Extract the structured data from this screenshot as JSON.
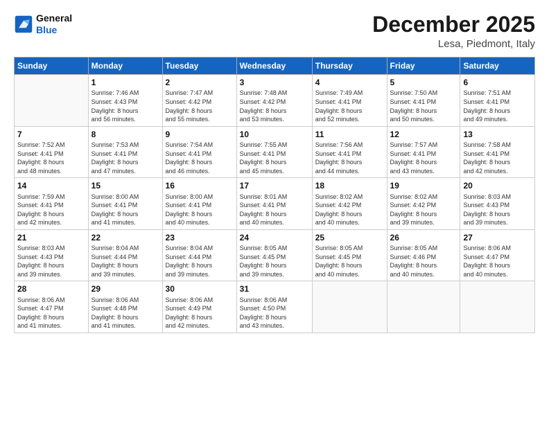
{
  "logo": {
    "line1": "General",
    "line2": "Blue"
  },
  "header": {
    "month": "December 2025",
    "location": "Lesa, Piedmont, Italy"
  },
  "days_of_week": [
    "Sunday",
    "Monday",
    "Tuesday",
    "Wednesday",
    "Thursday",
    "Friday",
    "Saturday"
  ],
  "weeks": [
    [
      {
        "day": "",
        "info": ""
      },
      {
        "day": "1",
        "info": "Sunrise: 7:46 AM\nSunset: 4:43 PM\nDaylight: 8 hours\nand 56 minutes."
      },
      {
        "day": "2",
        "info": "Sunrise: 7:47 AM\nSunset: 4:42 PM\nDaylight: 8 hours\nand 55 minutes."
      },
      {
        "day": "3",
        "info": "Sunrise: 7:48 AM\nSunset: 4:42 PM\nDaylight: 8 hours\nand 53 minutes."
      },
      {
        "day": "4",
        "info": "Sunrise: 7:49 AM\nSunset: 4:41 PM\nDaylight: 8 hours\nand 52 minutes."
      },
      {
        "day": "5",
        "info": "Sunrise: 7:50 AM\nSunset: 4:41 PM\nDaylight: 8 hours\nand 50 minutes."
      },
      {
        "day": "6",
        "info": "Sunrise: 7:51 AM\nSunset: 4:41 PM\nDaylight: 8 hours\nand 49 minutes."
      }
    ],
    [
      {
        "day": "7",
        "info": "Sunrise: 7:52 AM\nSunset: 4:41 PM\nDaylight: 8 hours\nand 48 minutes."
      },
      {
        "day": "8",
        "info": "Sunrise: 7:53 AM\nSunset: 4:41 PM\nDaylight: 8 hours\nand 47 minutes."
      },
      {
        "day": "9",
        "info": "Sunrise: 7:54 AM\nSunset: 4:41 PM\nDaylight: 8 hours\nand 46 minutes."
      },
      {
        "day": "10",
        "info": "Sunrise: 7:55 AM\nSunset: 4:41 PM\nDaylight: 8 hours\nand 45 minutes."
      },
      {
        "day": "11",
        "info": "Sunrise: 7:56 AM\nSunset: 4:41 PM\nDaylight: 8 hours\nand 44 minutes."
      },
      {
        "day": "12",
        "info": "Sunrise: 7:57 AM\nSunset: 4:41 PM\nDaylight: 8 hours\nand 43 minutes."
      },
      {
        "day": "13",
        "info": "Sunrise: 7:58 AM\nSunset: 4:41 PM\nDaylight: 8 hours\nand 42 minutes."
      }
    ],
    [
      {
        "day": "14",
        "info": "Sunrise: 7:59 AM\nSunset: 4:41 PM\nDaylight: 8 hours\nand 42 minutes."
      },
      {
        "day": "15",
        "info": "Sunrise: 8:00 AM\nSunset: 4:41 PM\nDaylight: 8 hours\nand 41 minutes."
      },
      {
        "day": "16",
        "info": "Sunrise: 8:00 AM\nSunset: 4:41 PM\nDaylight: 8 hours\nand 40 minutes."
      },
      {
        "day": "17",
        "info": "Sunrise: 8:01 AM\nSunset: 4:41 PM\nDaylight: 8 hours\nand 40 minutes."
      },
      {
        "day": "18",
        "info": "Sunrise: 8:02 AM\nSunset: 4:42 PM\nDaylight: 8 hours\nand 40 minutes."
      },
      {
        "day": "19",
        "info": "Sunrise: 8:02 AM\nSunset: 4:42 PM\nDaylight: 8 hours\nand 39 minutes."
      },
      {
        "day": "20",
        "info": "Sunrise: 8:03 AM\nSunset: 4:43 PM\nDaylight: 8 hours\nand 39 minutes."
      }
    ],
    [
      {
        "day": "21",
        "info": "Sunrise: 8:03 AM\nSunset: 4:43 PM\nDaylight: 8 hours\nand 39 minutes."
      },
      {
        "day": "22",
        "info": "Sunrise: 8:04 AM\nSunset: 4:44 PM\nDaylight: 8 hours\nand 39 minutes."
      },
      {
        "day": "23",
        "info": "Sunrise: 8:04 AM\nSunset: 4:44 PM\nDaylight: 8 hours\nand 39 minutes."
      },
      {
        "day": "24",
        "info": "Sunrise: 8:05 AM\nSunset: 4:45 PM\nDaylight: 8 hours\nand 39 minutes."
      },
      {
        "day": "25",
        "info": "Sunrise: 8:05 AM\nSunset: 4:45 PM\nDaylight: 8 hours\nand 40 minutes."
      },
      {
        "day": "26",
        "info": "Sunrise: 8:05 AM\nSunset: 4:46 PM\nDaylight: 8 hours\nand 40 minutes."
      },
      {
        "day": "27",
        "info": "Sunrise: 8:06 AM\nSunset: 4:47 PM\nDaylight: 8 hours\nand 40 minutes."
      }
    ],
    [
      {
        "day": "28",
        "info": "Sunrise: 8:06 AM\nSunset: 4:47 PM\nDaylight: 8 hours\nand 41 minutes."
      },
      {
        "day": "29",
        "info": "Sunrise: 8:06 AM\nSunset: 4:48 PM\nDaylight: 8 hours\nand 41 minutes."
      },
      {
        "day": "30",
        "info": "Sunrise: 8:06 AM\nSunset: 4:49 PM\nDaylight: 8 hours\nand 42 minutes."
      },
      {
        "day": "31",
        "info": "Sunrise: 8:06 AM\nSunset: 4:50 PM\nDaylight: 8 hours\nand 43 minutes."
      },
      {
        "day": "",
        "info": ""
      },
      {
        "day": "",
        "info": ""
      },
      {
        "day": "",
        "info": ""
      }
    ]
  ]
}
